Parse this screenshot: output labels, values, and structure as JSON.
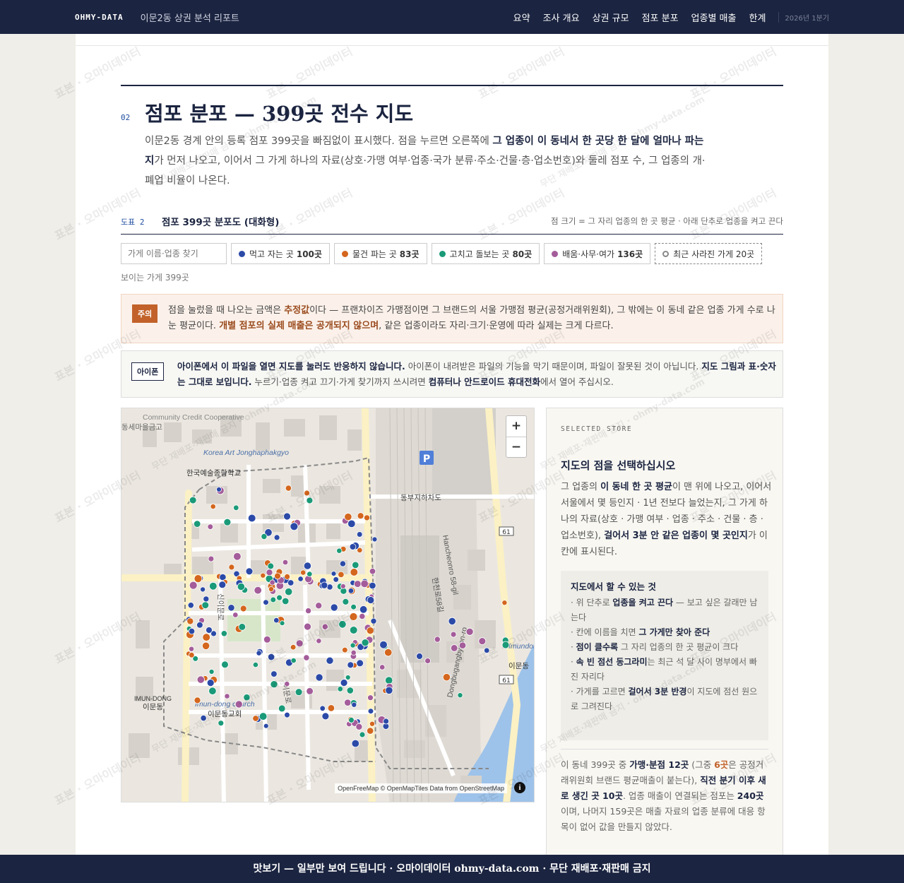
{
  "nav": {
    "brand": "OHMY-DATA",
    "report_title": "이문2동 상권 분석 리포트",
    "links": [
      "요약",
      "조사 개요",
      "상권 규모",
      "점포 분포",
      "업종별 매출",
      "한계"
    ],
    "period": "2026년 1분기"
  },
  "section": {
    "number": "02",
    "title": "점포 분포 — 399곳 전수 지도",
    "desc_1": "이문2동 경계 안의 등록 점포 399곳을 빠짐없이 표시했다. 점을 누르면 오른쪽에 ",
    "desc_bold": "그 업종이 이 동네서 한 곳당 한 달에 얼마나 파는지",
    "desc_2": "가 먼저 나오고, 이어서 그 가게 하나의 자료(상호·가맹 여부·업종·국가 분류·주소·건물·층·업소번호)와 둘레 점포 수, 그 업종의 개·폐업 비율이 나온다."
  },
  "figure": {
    "number": "도표 2",
    "title": "점포 399곳 분포도 (대화형)",
    "note": "점 크기 = 그 자리 업종의 한 곳 평균 · 아래 단추로 업종을 켜고 끈다"
  },
  "filters": {
    "search_placeholder": "가게 이름·업종 찾기",
    "chips": [
      {
        "label": "먹고 자는 곳",
        "count": "100곳",
        "color": "#2b4aa8"
      },
      {
        "label": "물건 파는 곳",
        "count": "83곳",
        "color": "#d4661d"
      },
      {
        "label": "고치고 돌보는 곳",
        "count": "80곳",
        "color": "#1a9a78"
      },
      {
        "label": "배움·사무·여가",
        "count": "136곳",
        "color": "#a45c9a"
      }
    ],
    "closed_chip": "최근 사라진 가게 20곳",
    "visible_count": "보이는 가게 399곳"
  },
  "warning": {
    "tag": "주의",
    "t1": "점을 눌렀을 때 나오는 금액은 ",
    "b1": "추정값",
    "t2": "이다 — 프랜차이즈 가맹점이면 그 브랜드의 서울 가맹점 평균(공정거래위원회), 그 밖에는 이 동네 같은 업종 가게 수로 나눈 평균이다. ",
    "b2": "개별 점포의 실제 매출은 공개되지 않으며",
    "t3": ", 같은 업종이라도 자리·크기·운영에 따라 실제는 크게 다르다."
  },
  "iphone": {
    "tag": "아이폰",
    "b1": "아이폰에서 이 파일을 열면 지도를 눌러도 반응하지 않습니다.",
    "t1": " 아이폰이 내려받은 파일의 기능을 막기 때문이며, 파일이 잘못된 것이 아닙니다. ",
    "b2": "지도 그림과 표·숫자는 그대로 보입니다.",
    "t2": " 누르기·업종 켜고 끄기·가게 찾기까지 쓰시려면 ",
    "b3": "컴퓨터나 안드로이드 휴대전화",
    "t3": "에서 열어 주십시오."
  },
  "map": {
    "zoom_in": "+",
    "zoom_out": "−",
    "attribution": "OpenFreeMap © OpenMapTiles Data from OpenStreetMap",
    "info": "i",
    "labels": {
      "a": "Korea Art Jonghaphakgyo",
      "b": "한국예술종합학교",
      "c": "동부지하차도",
      "d": "IMUN-DONG",
      "e": "이문동",
      "f": "Imun-dong church",
      "g": "이문동교회",
      "h": "Hancheonro 58-gil",
      "i": "한천로58길",
      "j": "Dongbugangbyeon-ro",
      "k": "Imundong Apt",
      "l": "이문동",
      "m": "Community Credit Cooperative",
      "n": "동세마을금고",
      "o": "신이문로",
      "p": "이문로",
      "q": "61",
      "r": "P"
    }
  },
  "panel": {
    "eyebrow": "SELECTED STORE",
    "title": "지도의 점을 선택하십시오",
    "d1": "그 업종의 ",
    "db1": "이 동네 한 곳 평균",
    "d2": "이 맨 위에 나오고, 이어서 서울에서 몇 등인지 · 1년 전보다 늘었는지, 그 가게 하나의 자료(상호 · 가맹 여부 · 업종 · 주소 · 건물 · 층 · 업소번호), ",
    "db2": "걸어서 3분 안 같은 업종이 몇 곳인지",
    "d3": "가 이 칸에 표시된다.",
    "howto_title": "지도에서 할 수 있는 것",
    "h1a": "· 위 단추로 ",
    "h1b": "업종을 켜고 끈다",
    "h1c": " — 보고 싶은 갈래만 남는다",
    "h2a": "· 칸에 이름을 치면 ",
    "h2b": "그 가게만 찾아 준다",
    "h3a": "· ",
    "h3b": "점이 클수록",
    "h3c": " 그 자리 업종의 한 곳 평균이 크다",
    "h4a": "· ",
    "h4b": "속 빈 점선 동그라미",
    "h4c": "는 최근 석 달 사이 명부에서 빠진 자리다",
    "h5a": "· 가게를 고르면 ",
    "h5b": "걸어서 3분 반경",
    "h5c": "이 지도에 점선 원으로 그려진다",
    "s1": "이 동네 399곳 중 ",
    "sb1": "가맹·분점 12곳",
    "s2": " (그중 ",
    "sb2": "6곳",
    "s3": "은 공정거래위원회 브랜드 평균매출이 붙는다), ",
    "sb3": "직전 분기 이후 새로 생긴 곳 10곳",
    "s4": ". 업종 매출이 연결되는 점포는 ",
    "sb4": "240곳",
    "s5": "이며, 나머지 159곳은 매출 자료의 업종 분류에 대응 항목이 없어 값을 만들지 않았다."
  },
  "watermark": "표본 · 오마이데이터",
  "watermark_2": "무단 재배포·재판매 금지 · ohmy-data.com",
  "footer": "맛보기 — 일부만 보여 드립니다 · 오마이데이터 ohmy-data.com · 무단 재배포·재판매 금지"
}
